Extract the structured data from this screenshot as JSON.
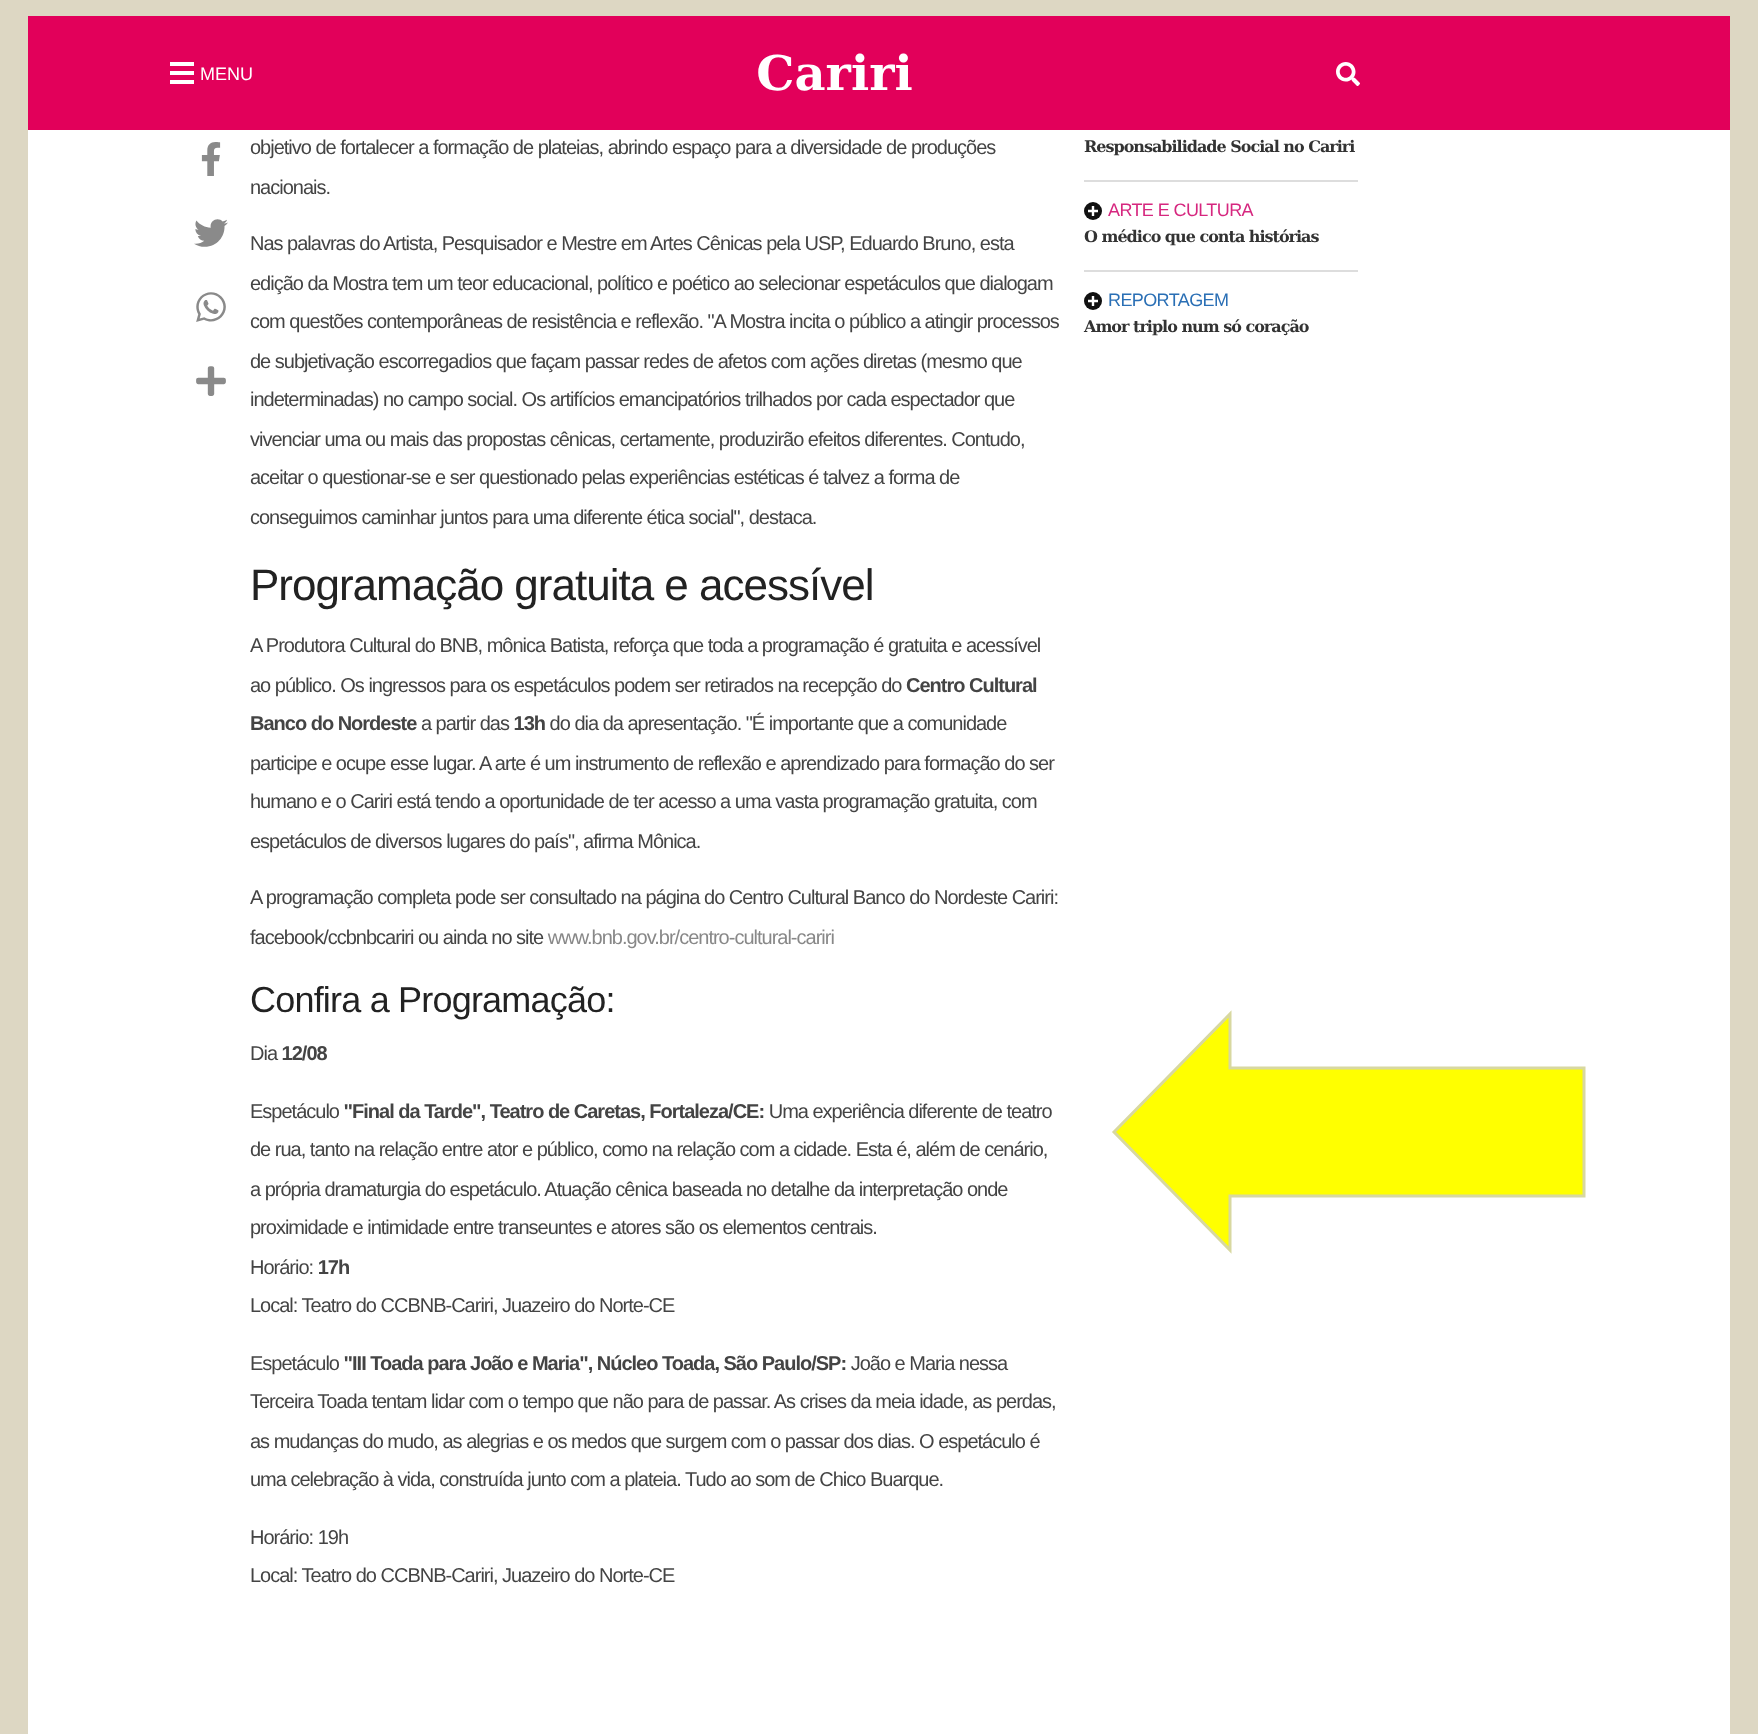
{
  "header": {
    "menu_label": "MENU",
    "logo": "Cariri"
  },
  "share": [
    {
      "kind": "facebook"
    },
    {
      "kind": "twitter"
    },
    {
      "kind": "whatsapp"
    },
    {
      "kind": "more"
    }
  ],
  "article": [
    {
      "kind": "paragraph",
      "text": "objetivo de fortalecer a formação de plateias, abrindo espaço para a diversidade de produções nacionais."
    },
    {
      "kind": "paragraph",
      "text": "Nas palavras do Artista, Pesquisador e Mestre em Artes Cênicas pela USP, Eduardo Bruno, esta edição da Mostra tem um teor educacional, político e poético ao selecionar espetáculos que dialogam com questões contemporâneas de resistência e reflexão. \"A Mostra incita o público a atingir processos de subjetivação escorregadios que façam passar redes de afetos com ações diretas (mesmo que indeterminadas) no campo social. Os artifícios emancipatórios trilhados por cada espectador que vivenciar uma ou mais das propostas cênicas, certamente, produzirão efeitos diferentes. Contudo, aceitar o questionar-se e ser questionado pelas experiências estéticas é talvez a forma de conseguimos caminhar juntos para uma diferente ética social\", destaca."
    },
    {
      "kind": "heading",
      "text": "Programação gratuita e acessível"
    },
    {
      "kind": "paragraph",
      "text": "A Produtora Cultural do BNB, mônica Batista, reforça que toda a programação é gratuita e acessível ao público. Os ingressos para os espetáculos podem ser retirados na recepção do **Centro Cultural Banco do Nordeste** a partir das **13h** do dia da apresentação. \"É importante que a comunidade participe e ocupe esse lugar. A arte é um instrumento de reflexão e aprendizado para formação do ser humano e o Cariri está tendo a oportunidade de ter acesso a uma vasta programação gratuita, com espetáculos de diversos lugares do país\", afirma Mônica."
    },
    {
      "kind": "paragraph",
      "text": "A programação completa pode ser consultado na página do Centro Cultural Banco do Nordeste Cariri: facebook/ccbnbcariri ou ainda no site",
      "link": "www.bnb.gov.br/centro-cultural-cariri"
    },
    {
      "kind": "subheading",
      "text": "Confira a Programação:"
    },
    {
      "kind": "paragraph",
      "text": "Dia **12/08**"
    },
    {
      "kind": "paragraph",
      "text": "Espetáculo **\"Final da Tarde\", Teatro de Caretas, Fortaleza/CE:** Uma experiência diferente de teatro de rua, tanto na relação entre ator e público, como na relação com a cidade. Esta é, além de cenário, a própria dramaturgia do espetáculo. Atuação cênica baseada no detalhe da interpretação onde proximidade e intimidade entre transeuntes e atores são os elementos centrais.",
      "lines": [
        "Horário: **17h**",
        "Local: Teatro do CCBNB-Cariri, Juazeiro do Norte-CE"
      ]
    },
    {
      "kind": "paragraph",
      "text": "Espetáculo **\"III Toada para João e Maria\", Núcleo Toada, São Paulo/SP:** João e Maria nessa Terceira Toada tentam lidar com o tempo que não para de passar. As crises da meia idade, as perdas, as mudanças do mudo, as alegrias e os medos que surgem com o passar dos dias. O espetáculo é uma celebração à vida, construída junto com a plateia. Tudo ao som de Chico Buarque."
    },
    {
      "kind": "paragraph",
      "text": "Horário: 19h",
      "lines": [
        "Local: Teatro do CCBNB-Cariri, Juazeiro do Norte-CE"
      ]
    }
  ],
  "sidebar": [
    {
      "title": "Responsabilidade Social no Cariri"
    },
    {
      "category": "ARTE E CULTURA",
      "color": "#d6277f",
      "title": "O médico que conta histórias"
    },
    {
      "category": "REPORTAGEM",
      "color": "#2a6fb5",
      "title": "Amor triplo num só coração"
    }
  ]
}
